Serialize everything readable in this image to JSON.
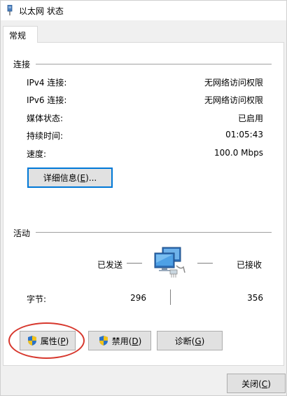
{
  "window": {
    "title": "以太网 状态"
  },
  "tabs": [
    {
      "label": "常规"
    }
  ],
  "connection": {
    "section_title": "连接",
    "rows": [
      {
        "label": "IPv4 连接:",
        "value": "无网络访问权限"
      },
      {
        "label": "IPv6 连接:",
        "value": "无网络访问权限"
      },
      {
        "label": "媒体状态:",
        "value": "已启用"
      },
      {
        "label": "持续时间:",
        "value": "01:05:43"
      },
      {
        "label": "速度:",
        "value": "100.0 Mbps"
      }
    ],
    "details_button": {
      "text": "详细信息(",
      "key": "E",
      "suffix": ")..."
    }
  },
  "activity": {
    "section_title": "活动",
    "sent_label": "已发送",
    "received_label": "已接收",
    "bytes_label": "字节:",
    "bytes_sent": "296",
    "bytes_received": "356"
  },
  "buttons": {
    "properties": {
      "text": "属性(",
      "key": "P",
      "suffix": ")"
    },
    "disable": {
      "text": "禁用(",
      "key": "D",
      "suffix": ")"
    },
    "diagnose": {
      "text": "诊断(",
      "key": "G",
      "suffix": ")"
    },
    "close": {
      "text": "关闭(",
      "key": "C",
      "suffix": ")"
    }
  },
  "colors": {
    "accent": "#0078d7",
    "annotation": "#d7382e"
  }
}
